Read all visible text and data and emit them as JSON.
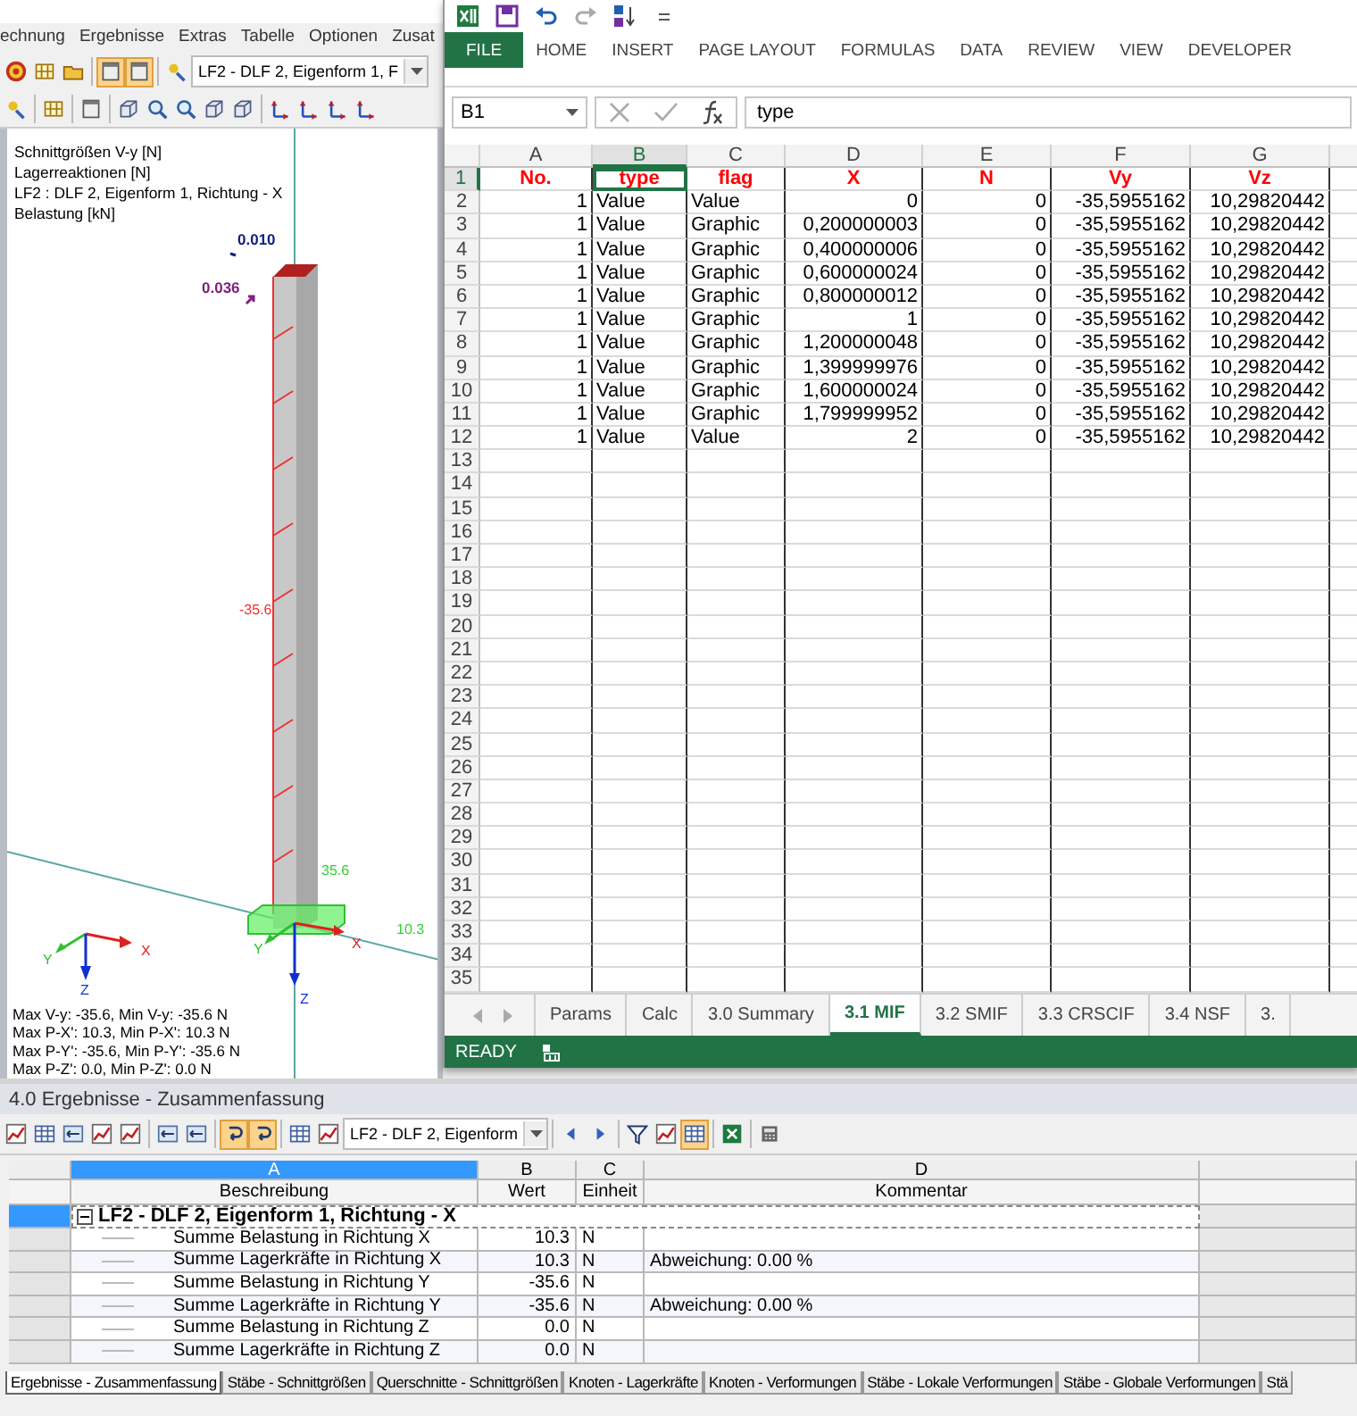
{
  "rfem": {
    "menu": [
      "echnung",
      "Ergebnisse",
      "Extras",
      "Tabelle",
      "Optionen",
      "Zusat"
    ],
    "toolbar_1": [
      {
        "kind": "button",
        "on": false
      },
      {
        "kind": "button",
        "on": false
      },
      {
        "kind": "button",
        "on": false
      },
      {
        "kind": "separator"
      },
      {
        "kind": "button",
        "on": true
      },
      {
        "kind": "button",
        "on": true
      },
      {
        "kind": "separator"
      },
      {
        "kind": "button",
        "on": false
      },
      {
        "kind": "dropdown",
        "value": "LF2 - DLF 2, Eigenform 1, F"
      }
    ],
    "toolbar_2": [
      {
        "kind": "button",
        "on": false
      },
      {
        "kind": "separator"
      },
      {
        "kind": "button",
        "on": false
      },
      {
        "kind": "separator"
      },
      {
        "kind": "button",
        "on": false
      },
      {
        "kind": "separator"
      },
      {
        "kind": "button",
        "on": false
      },
      {
        "kind": "button",
        "on": false
      },
      {
        "kind": "button",
        "on": false
      },
      {
        "kind": "button",
        "on": false
      },
      {
        "kind": "button",
        "on": false
      },
      {
        "kind": "separator"
      },
      {
        "kind": "button",
        "on": false
      },
      {
        "kind": "button",
        "on": false
      },
      {
        "kind": "button",
        "on": false
      },
      {
        "kind": "button",
        "on": false
      }
    ],
    "view": {
      "info": [
        "Schnittgrößen V-y [N]",
        "Lagerreaktionen [N]",
        "LF2 : DLF 2, Eigenform 1, Richtung - X",
        "Belastung [kN]"
      ],
      "load_labels": [
        "0.010",
        "0.036"
      ],
      "member_label": "-35.6",
      "reaction_labels": [
        "35.6",
        "10.3"
      ],
      "local_axes": [
        "X",
        "Y",
        "Z"
      ],
      "global_axes": [
        "X",
        "Y",
        "Z"
      ],
      "summary": [
        "Max V-y: -35.6, Min V-y: -35.6 N",
        "Max P-X': 10.3, Min P-X': 10.3 N",
        "Max P-Y': -35.6, Min P-Y': -35.6 N",
        "Max P-Z': 0.0, Min P-Z': 0.0 N"
      ]
    }
  },
  "excel": {
    "ribbon_tabs": [
      {
        "label": "FILE",
        "kind": "file"
      },
      {
        "label": "HOME",
        "kind": "tab"
      },
      {
        "label": "INSERT",
        "kind": "tab"
      },
      {
        "label": "PAGE LAYOUT",
        "kind": "tab"
      },
      {
        "label": "FORMULAS",
        "kind": "tab"
      },
      {
        "label": "DATA",
        "kind": "tab"
      },
      {
        "label": "REVIEW",
        "kind": "tab"
      },
      {
        "label": "VIEW",
        "kind": "tab"
      },
      {
        "label": "DEVELOPER",
        "kind": "tab"
      }
    ],
    "name_box": "B1",
    "formula": "type",
    "columns": [
      {
        "letter": "A",
        "kind": "number",
        "selected": false
      },
      {
        "letter": "B",
        "kind": "text",
        "selected": true
      },
      {
        "letter": "C",
        "kind": "text",
        "selected": false
      },
      {
        "letter": "D",
        "kind": "number",
        "selected": false
      },
      {
        "letter": "E",
        "kind": "number",
        "selected": false
      },
      {
        "letter": "F",
        "kind": "number",
        "selected": false
      },
      {
        "letter": "G",
        "kind": "number",
        "selected": false
      }
    ],
    "rows": [
      {
        "number": "1",
        "kind": "heading",
        "selected": true,
        "cells": [
          "No.",
          "type",
          "flag",
          "X",
          "N",
          "Vy",
          "Vz"
        ]
      },
      {
        "number": "2",
        "kind": "data",
        "selected": false,
        "cells": [
          "1",
          "Value",
          "Value",
          "0",
          "0",
          "-35,5955162",
          "10,29820442"
        ]
      },
      {
        "number": "3",
        "kind": "data",
        "selected": false,
        "cells": [
          "1",
          "Value",
          "Graphic",
          "0,200000003",
          "0",
          "-35,5955162",
          "10,29820442"
        ]
      },
      {
        "number": "4",
        "kind": "data",
        "selected": false,
        "cells": [
          "1",
          "Value",
          "Graphic",
          "0,400000006",
          "0",
          "-35,5955162",
          "10,29820442"
        ]
      },
      {
        "number": "5",
        "kind": "data",
        "selected": false,
        "cells": [
          "1",
          "Value",
          "Graphic",
          "0,600000024",
          "0",
          "-35,5955162",
          "10,29820442"
        ]
      },
      {
        "number": "6",
        "kind": "data",
        "selected": false,
        "cells": [
          "1",
          "Value",
          "Graphic",
          "0,800000012",
          "0",
          "-35,5955162",
          "10,29820442"
        ]
      },
      {
        "number": "7",
        "kind": "data",
        "selected": false,
        "cells": [
          "1",
          "Value",
          "Graphic",
          "1",
          "0",
          "-35,5955162",
          "10,29820442"
        ]
      },
      {
        "number": "8",
        "kind": "data",
        "selected": false,
        "cells": [
          "1",
          "Value",
          "Graphic",
          "1,200000048",
          "0",
          "-35,5955162",
          "10,29820442"
        ]
      },
      {
        "number": "9",
        "kind": "data",
        "selected": false,
        "cells": [
          "1",
          "Value",
          "Graphic",
          "1,399999976",
          "0",
          "-35,5955162",
          "10,29820442"
        ]
      },
      {
        "number": "10",
        "kind": "data",
        "selected": false,
        "cells": [
          "1",
          "Value",
          "Graphic",
          "1,600000024",
          "0",
          "-35,5955162",
          "10,29820442"
        ]
      },
      {
        "number": "11",
        "kind": "data",
        "selected": false,
        "cells": [
          "1",
          "Value",
          "Graphic",
          "1,799999952",
          "0",
          "-35,5955162",
          "10,29820442"
        ]
      },
      {
        "number": "12",
        "kind": "data",
        "selected": false,
        "cells": [
          "1",
          "Value",
          "Value",
          "2",
          "0",
          "-35,5955162",
          "10,29820442"
        ]
      },
      {
        "number": "13",
        "kind": "empty",
        "selected": false
      },
      {
        "number": "14",
        "kind": "empty",
        "selected": false
      },
      {
        "number": "15",
        "kind": "empty",
        "selected": false
      },
      {
        "number": "16",
        "kind": "empty",
        "selected": false
      },
      {
        "number": "17",
        "kind": "empty",
        "selected": false
      },
      {
        "number": "18",
        "kind": "empty",
        "selected": false
      },
      {
        "number": "19",
        "kind": "empty",
        "selected": false
      },
      {
        "number": "20",
        "kind": "empty",
        "selected": false
      },
      {
        "number": "21",
        "kind": "empty",
        "selected": false
      },
      {
        "number": "22",
        "kind": "empty",
        "selected": false
      },
      {
        "number": "23",
        "kind": "empty",
        "selected": false
      },
      {
        "number": "24",
        "kind": "empty",
        "selected": false
      },
      {
        "number": "25",
        "kind": "empty",
        "selected": false
      },
      {
        "number": "26",
        "kind": "empty",
        "selected": false
      },
      {
        "number": "27",
        "kind": "empty",
        "selected": false
      },
      {
        "number": "28",
        "kind": "empty",
        "selected": false
      },
      {
        "number": "29",
        "kind": "empty",
        "selected": false
      },
      {
        "number": "30",
        "kind": "empty",
        "selected": false
      },
      {
        "number": "31",
        "kind": "empty",
        "selected": false
      },
      {
        "number": "32",
        "kind": "empty",
        "selected": false
      },
      {
        "number": "33",
        "kind": "empty",
        "selected": false
      },
      {
        "number": "34",
        "kind": "empty",
        "selected": false
      },
      {
        "number": "35",
        "kind": "empty",
        "selected": false
      }
    ],
    "sheet_tabs": [
      {
        "label": "Params",
        "selected": false
      },
      {
        "label": "Calc",
        "selected": false
      },
      {
        "label": "3.0 Summary",
        "selected": false
      },
      {
        "label": "3.1 MIF",
        "selected": true
      },
      {
        "label": "3.2 SMIF",
        "selected": false
      },
      {
        "label": "3.3 CRSCIF",
        "selected": false
      },
      {
        "label": "3.4 NSF",
        "selected": false
      },
      {
        "label": "3.",
        "selected": false
      }
    ],
    "status": "READY"
  },
  "results": {
    "title": "4.0 Ergebnisse - Zusammenfassung",
    "toolbar": [
      {
        "kind": "button",
        "on": false
      },
      {
        "kind": "button",
        "on": false
      },
      {
        "kind": "button",
        "on": false
      },
      {
        "kind": "button",
        "on": false
      },
      {
        "kind": "button",
        "on": false
      },
      {
        "kind": "separator"
      },
      {
        "kind": "button",
        "on": false
      },
      {
        "kind": "button",
        "on": false
      },
      {
        "kind": "separator"
      },
      {
        "kind": "button",
        "on": true
      },
      {
        "kind": "button",
        "on": true
      },
      {
        "kind": "separator"
      },
      {
        "kind": "button",
        "on": false
      },
      {
        "kind": "button",
        "on": false
      },
      {
        "kind": "dropdown",
        "value": "LF2 - DLF 2, Eigenform"
      },
      {
        "kind": "separator"
      },
      {
        "kind": "button",
        "on": false
      },
      {
        "kind": "button",
        "on": false
      },
      {
        "kind": "separator"
      },
      {
        "kind": "button",
        "on": false
      },
      {
        "kind": "button",
        "on": false
      },
      {
        "kind": "button",
        "on": true
      },
      {
        "kind": "separator"
      },
      {
        "kind": "button",
        "on": false
      },
      {
        "kind": "separator"
      },
      {
        "kind": "button",
        "on": false
      }
    ],
    "columns": [
      {
        "letter": "A",
        "title": "Beschreibung",
        "selected": true
      },
      {
        "letter": "B",
        "title": "Wert",
        "selected": false
      },
      {
        "letter": "C",
        "title": "Einheit",
        "selected": false
      },
      {
        "letter": "D",
        "title": "Kommentar",
        "selected": false
      }
    ],
    "group": {
      "label": "LF2 - DLF 2, Eigenform 1, Richtung - X",
      "expanded": true,
      "selected": true
    },
    "rows": [
      {
        "description": "Summe Belastung in Richtung X",
        "value": "10.3",
        "unit": "N"
      },
      {
        "description": "Summe Lagerkräfte in Richtung X",
        "value": "10.3",
        "unit": "N",
        "comment": "Abweichung:  0.00 %"
      },
      {
        "description": "Summe Belastung in Richtung Y",
        "value": "-35.6",
        "unit": "N"
      },
      {
        "description": "Summe Lagerkräfte in Richtung Y",
        "value": "-35.6",
        "unit": "N",
        "comment": "Abweichung:  0.00 %"
      },
      {
        "description": "Summe Belastung in Richtung Z",
        "value": "0.0",
        "unit": "N"
      },
      {
        "description": "Summe Lagerkräfte in Richtung Z",
        "value": "0.0",
        "unit": "N"
      }
    ],
    "tabs": [
      {
        "label": "Ergebnisse - Zusammenfassung",
        "selected": true
      },
      {
        "label": "Stäbe - Schnittgrößen",
        "selected": false
      },
      {
        "label": "Querschnitte - Schnittgrößen",
        "selected": false
      },
      {
        "label": "Knoten - Lagerkräfte",
        "selected": false
      },
      {
        "label": "Knoten - Verformungen",
        "selected": false
      },
      {
        "label": "Stäbe - Lokale Verformungen",
        "selected": false
      },
      {
        "label": "Stäbe - Globale Verformungen",
        "selected": false
      },
      {
        "label": "Stä",
        "selected": false
      }
    ]
  }
}
